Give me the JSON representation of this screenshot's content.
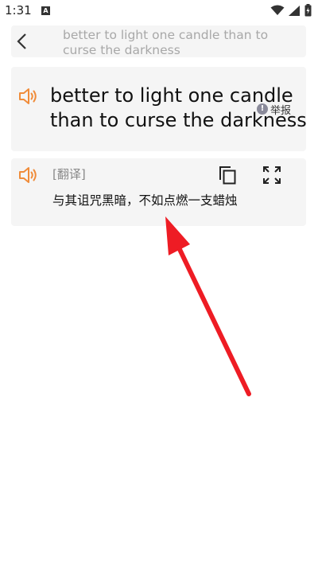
{
  "status_bar": {
    "time": "1:31",
    "notification_letter": "A"
  },
  "header": {
    "title": "better to light one candle than to curse the darkness"
  },
  "source": {
    "text_line1": "better to light one candle",
    "text_line2": "than to curse the darkness",
    "report_label": "举报",
    "report_icon_glyph": "!"
  },
  "translation": {
    "label": "[翻译]",
    "text": "与其诅咒黑暗，不如点燃一支蜡烛"
  },
  "colors": {
    "accent": "#f08c3a",
    "arrow": "#ee1c24",
    "card_bg": "#f5f5f5"
  },
  "icons": {
    "back": "chevron-left-icon",
    "speaker": "speaker-icon",
    "copy": "copy-icon",
    "fullscreen": "fullscreen-icon",
    "report": "info-icon"
  }
}
